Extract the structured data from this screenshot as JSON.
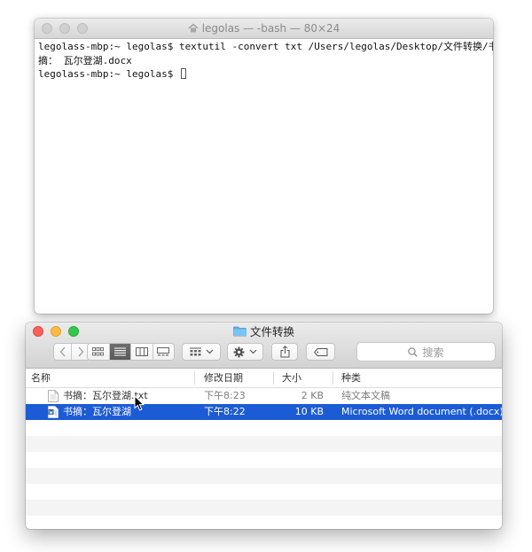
{
  "terminal": {
    "title": "legolas — -bash — 80×24",
    "lines": [
      "legolass-mbp:~ legolas$ textutil -convert txt /Users/legolas/Desktop/文件转换/书",
      "摘： 瓦尔登湖.docx",
      "legolass-mbp:~ legolas$ "
    ]
  },
  "finder": {
    "title": "文件转换",
    "search_placeholder": "搜索",
    "columns": {
      "name": "名称",
      "date": "修改日期",
      "size": "大小",
      "kind": "种类"
    },
    "files": [
      {
        "name": "书摘：瓦尔登湖.txt",
        "date": "下午8:23",
        "size": "2 KB",
        "kind": "纯文本文稿",
        "icon": "text-file-icon",
        "selected": false
      },
      {
        "name": "书摘：瓦尔登湖",
        "date": "下午8:22",
        "size": "10 KB",
        "kind": "Microsoft Word document (.docx)",
        "icon": "word-file-icon",
        "selected": true
      }
    ]
  },
  "colors": {
    "selection": "#1c5bd6",
    "close": "#fc605b",
    "minimize": "#fdbc40",
    "zoom": "#34c84a",
    "folder": "#5fb3f2"
  }
}
